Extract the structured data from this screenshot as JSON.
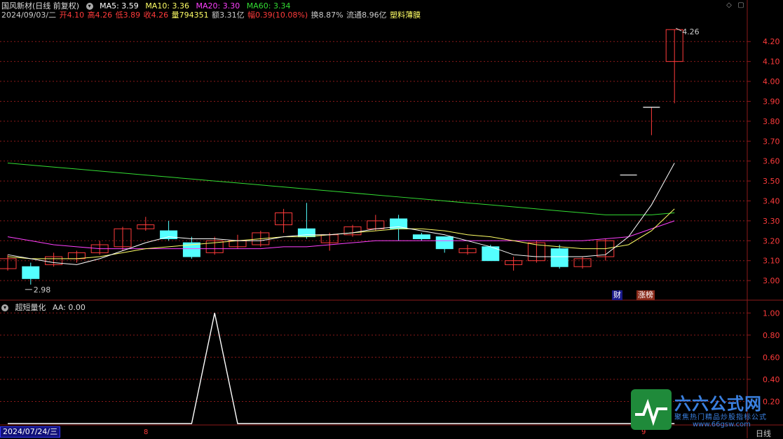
{
  "header": {
    "stock_name": "国风新材(日线 前复权)",
    "ma5": "MA5: 3.59",
    "ma10": "MA10: 3.36",
    "ma20": "MA20: 3.30",
    "ma60": "MA60: 3.34"
  },
  "info": {
    "date": "2024/09/03/二",
    "open": "开4.10",
    "high": "高4.26",
    "low": "低3.89",
    "close": "收4.26",
    "volume": "量794351",
    "amount": "额3.31亿",
    "change": "幅0.39(10.08%)",
    "turnover": "换8.87%",
    "float_cap": "流通8.96亿",
    "sector": "塑料薄膜"
  },
  "sub_panel": {
    "title": "超短量化",
    "value": "AA: 0.00"
  },
  "footer": {
    "date": "2024/07/24/三",
    "period": "日线",
    "marker_left": "8",
    "marker_right": "9"
  },
  "badges": {
    "cai": "财",
    "zhangbang": "涨榜"
  },
  "logo": {
    "title": "六六公式网",
    "subtitle": "聚焦热门精品炒股指标公式",
    "url": "www.66gsw.com"
  },
  "colors": {
    "up": "#ff3b3b",
    "down": "#54ffff",
    "ma5": "#ffffff",
    "ma10": "#ffff66",
    "ma20": "#ff40ff",
    "ma60": "#33dd33",
    "grid": "#8b1a1a"
  },
  "chart_data": [
    {
      "type": "candlestick",
      "ylim": [
        2.93,
        4.31
      ],
      "yticks": [
        "4.20",
        "4.10",
        "4.00",
        "3.90",
        "3.80",
        "3.70",
        "3.60",
        "3.50",
        "3.40",
        "3.30",
        "3.20",
        "3.10",
        "3.00"
      ],
      "max_label": "4.26",
      "min_label": "2.98",
      "candles": [
        {
          "o": 3.06,
          "c": 3.11,
          "h": 3.13,
          "l": 3.05
        },
        {
          "o": 3.07,
          "c": 3.01,
          "h": 3.09,
          "l": 2.98
        },
        {
          "o": 3.08,
          "c": 3.12,
          "h": 3.14,
          "l": 3.07
        },
        {
          "o": 3.11,
          "c": 3.14,
          "h": 3.15,
          "l": 3.09
        },
        {
          "o": 3.14,
          "c": 3.18,
          "h": 3.2,
          "l": 3.13
        },
        {
          "o": 3.17,
          "c": 3.26,
          "h": 3.27,
          "l": 3.15
        },
        {
          "o": 3.26,
          "c": 3.28,
          "h": 3.32,
          "l": 3.25
        },
        {
          "o": 3.25,
          "c": 3.21,
          "h": 3.3,
          "l": 3.2
        },
        {
          "o": 3.19,
          "c": 3.12,
          "h": 3.22,
          "l": 3.11
        },
        {
          "o": 3.14,
          "c": 3.2,
          "h": 3.22,
          "l": 3.13
        },
        {
          "o": 3.17,
          "c": 3.2,
          "h": 3.23,
          "l": 3.16
        },
        {
          "o": 3.18,
          "c": 3.24,
          "h": 3.25,
          "l": 3.17
        },
        {
          "o": 3.28,
          "c": 3.34,
          "h": 3.36,
          "l": 3.24
        },
        {
          "o": 3.26,
          "c": 3.22,
          "h": 3.39,
          "l": 3.21
        },
        {
          "o": 3.19,
          "c": 3.23,
          "h": 3.24,
          "l": 3.15
        },
        {
          "o": 3.23,
          "c": 3.27,
          "h": 3.28,
          "l": 3.22
        },
        {
          "o": 3.26,
          "c": 3.3,
          "h": 3.33,
          "l": 3.25
        },
        {
          "o": 3.31,
          "c": 3.26,
          "h": 3.33,
          "l": 3.2
        },
        {
          "o": 3.23,
          "c": 3.21,
          "h": 3.24,
          "l": 3.2
        },
        {
          "o": 3.22,
          "c": 3.16,
          "h": 3.22,
          "l": 3.14
        },
        {
          "o": 3.14,
          "c": 3.16,
          "h": 3.18,
          "l": 3.13
        },
        {
          "o": 3.17,
          "c": 3.1,
          "h": 3.18,
          "l": 3.1
        },
        {
          "o": 3.08,
          "c": 3.1,
          "h": 3.12,
          "l": 3.05
        },
        {
          "o": 3.1,
          "c": 3.19,
          "h": 3.2,
          "l": 3.09
        },
        {
          "o": 3.16,
          "c": 3.07,
          "h": 3.18,
          "l": 3.06
        },
        {
          "o": 3.07,
          "c": 3.11,
          "h": 3.12,
          "l": 3.06
        },
        {
          "o": 3.12,
          "c": 3.2,
          "h": 3.21,
          "l": 3.1
        },
        {
          "o": 3.53,
          "c": 3.53,
          "h": 3.53,
          "l": 3.53
        },
        {
          "o": 3.87,
          "c": 3.87,
          "h": 3.87,
          "l": 3.73
        },
        {
          "o": 4.1,
          "c": 4.26,
          "h": 4.26,
          "l": 3.89
        }
      ],
      "ma5": [
        3.13,
        3.11,
        3.09,
        3.08,
        3.11,
        3.15,
        3.19,
        3.22,
        3.21,
        3.21,
        3.2,
        3.2,
        3.22,
        3.23,
        3.23,
        3.24,
        3.26,
        3.27,
        3.25,
        3.23,
        3.2,
        3.17,
        3.13,
        3.12,
        3.12,
        3.12,
        3.13,
        3.22,
        3.38,
        3.59
      ],
      "ma10": [
        3.12,
        3.11,
        3.11,
        3.11,
        3.12,
        3.14,
        3.16,
        3.17,
        3.18,
        3.19,
        3.2,
        3.21,
        3.22,
        3.22,
        3.23,
        3.24,
        3.25,
        3.26,
        3.26,
        3.25,
        3.23,
        3.22,
        3.2,
        3.18,
        3.17,
        3.16,
        3.16,
        3.18,
        3.25,
        3.36
      ],
      "ma20": [
        3.22,
        3.2,
        3.18,
        3.17,
        3.16,
        3.16,
        3.16,
        3.16,
        3.16,
        3.16,
        3.16,
        3.16,
        3.17,
        3.17,
        3.18,
        3.19,
        3.2,
        3.2,
        3.2,
        3.2,
        3.2,
        3.2,
        3.2,
        3.2,
        3.2,
        3.2,
        3.21,
        3.22,
        3.26,
        3.3
      ],
      "ma60": [
        3.59,
        3.58,
        3.57,
        3.56,
        3.55,
        3.54,
        3.53,
        3.52,
        3.51,
        3.5,
        3.49,
        3.48,
        3.47,
        3.46,
        3.45,
        3.44,
        3.43,
        3.42,
        3.41,
        3.4,
        3.39,
        3.38,
        3.37,
        3.36,
        3.35,
        3.34,
        3.33,
        3.33,
        3.33,
        3.34
      ]
    },
    {
      "type": "line",
      "series_name": "AA",
      "ylim": [
        0,
        1.04
      ],
      "yticks": [
        "1.00",
        "0.80",
        "0.60",
        "0.40",
        "0.20"
      ],
      "values": [
        0,
        0,
        0,
        0,
        0,
        0,
        0,
        0,
        0,
        1,
        0,
        0,
        0,
        0,
        0,
        0,
        0,
        0,
        0,
        0,
        0,
        0,
        0,
        0,
        0,
        0,
        0,
        0,
        0,
        0
      ]
    }
  ]
}
